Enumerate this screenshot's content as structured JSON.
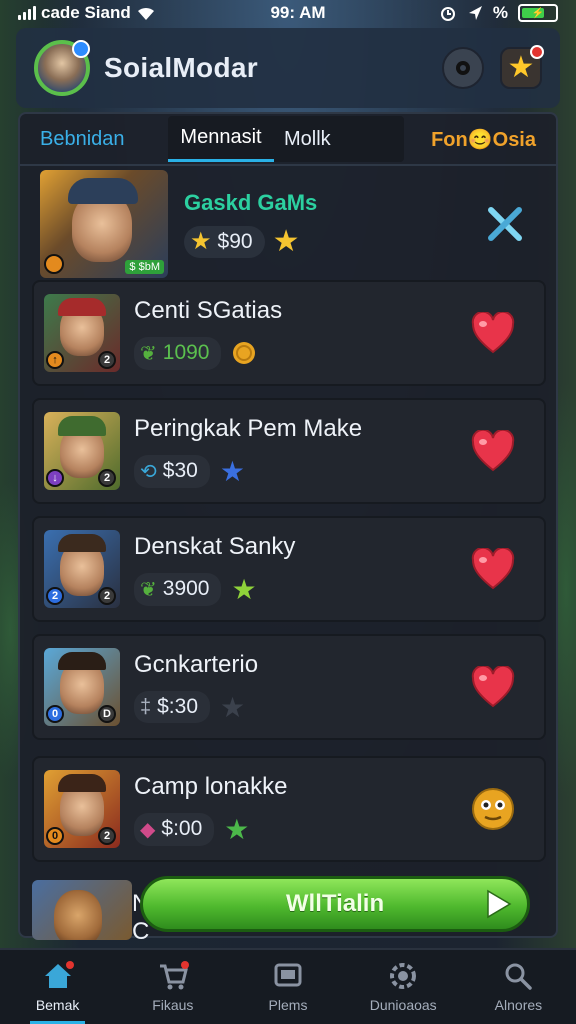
{
  "status_bar": {
    "carrier": "cade Siand",
    "time": "99: AM",
    "percent_symbol": "%"
  },
  "header": {
    "app_title": "SoialModar",
    "icons": [
      "avatar",
      "settings-icon",
      "favorites-star-icon"
    ]
  },
  "tabs": {
    "left": "Bebnidan",
    "active": "Mennasit",
    "middle": "Mollk",
    "right": "Fon😊Osia"
  },
  "featured": {
    "name": "Gaskd GaMs",
    "price": "$90",
    "thumb_tag": "$ $bM",
    "colors": {
      "name": "#2cd0a0"
    }
  },
  "cards": [
    {
      "name": "Centi SGatias",
      "value": "1090",
      "value_icon": "leaf-icon",
      "extra_icon": "coin-icon",
      "action_icon": "heart-icon"
    },
    {
      "name": "Peringkak Pem Make",
      "value": "$30",
      "value_icon": "link-icon",
      "extra_icon": "blue-star-icon",
      "action_icon": "heart-icon"
    },
    {
      "name": "Denskat Sanky",
      "value": "3900",
      "value_icon": "leaf-icon",
      "extra_icon": "green-star-icon",
      "action_icon": "heart-icon"
    },
    {
      "name": "Gcnkarterio",
      "value": "$:30",
      "value_icon": "ruler-icon",
      "extra_icon": "gray-star-icon",
      "action_icon": "heart-icon"
    },
    {
      "name": "Camp lonakke",
      "value": "$:00",
      "value_icon": "gem-icon",
      "extra_icon": "green-star-icon",
      "action_icon": "emoji-icon"
    }
  ],
  "partial_card": {
    "name": "N",
    "sub": "C"
  },
  "cta": {
    "label": "WllTialin"
  },
  "bottom_nav": [
    {
      "label": "Bemak",
      "icon": "home-icon",
      "active": true
    },
    {
      "label": "Fikaus",
      "icon": "cart-icon",
      "active": false
    },
    {
      "label": "Plems",
      "icon": "screen-icon",
      "active": false
    },
    {
      "label": "Dunioaoas",
      "icon": "gear-icon",
      "active": false
    },
    {
      "label": "Alnores",
      "icon": "search-icon",
      "active": false
    }
  ],
  "colors": {
    "accent": "#2ab1e6",
    "cta": "#4fb92e",
    "heart": "#e8344a"
  }
}
